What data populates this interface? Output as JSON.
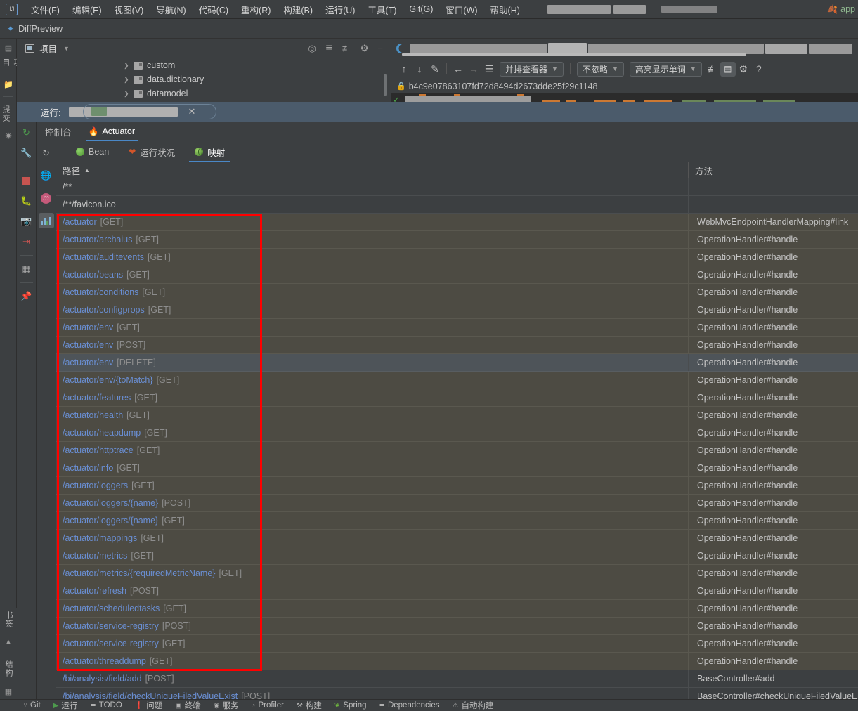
{
  "menubar": {
    "logo": "IJ",
    "items": [
      {
        "label": "文件(F)",
        "name": "menu-file"
      },
      {
        "label": "编辑(E)",
        "name": "menu-edit"
      },
      {
        "label": "视图(V)",
        "name": "menu-view"
      },
      {
        "label": "导航(N)",
        "name": "menu-navigate"
      },
      {
        "label": "代码(C)",
        "name": "menu-code"
      },
      {
        "label": "重构(R)",
        "name": "menu-refactor"
      },
      {
        "label": "构建(B)",
        "name": "menu-build"
      },
      {
        "label": "运行(U)",
        "name": "menu-run"
      },
      {
        "label": "工具(T)",
        "name": "menu-tools"
      },
      {
        "label": "Git(G)",
        "name": "menu-git"
      },
      {
        "label": "窗口(W)",
        "name": "menu-window"
      },
      {
        "label": "帮助(H)",
        "name": "menu-help"
      }
    ]
  },
  "navbar": {
    "breadcrumb": "DiffPreview",
    "star_icon": "star-icon"
  },
  "left_rail": {
    "top_label": "项目",
    "mid_label": "提交",
    "bottom_labels": [
      "书签",
      "结构"
    ]
  },
  "project_panel": {
    "title": "项目",
    "tools": [
      "locate-icon",
      "expand-all-icon",
      "collapse-all-icon",
      "gear-icon",
      "minimize-icon"
    ],
    "tree": [
      {
        "label": "custom"
      },
      {
        "label": "data.dictionary"
      },
      {
        "label": "datamodel"
      }
    ]
  },
  "diff_panel": {
    "app_chip_label": "app",
    "toolbar": {
      "prev_diff": "arrow-up-icon",
      "next_diff": "arrow-down-icon",
      "edit": "pencil-icon",
      "accept_left": "arrow-left-icon",
      "accept_right": "arrow-right-icon",
      "lines": "lines-icon",
      "viewer_mode": "并排查看器",
      "ignore_policy": "不忽略",
      "highlight_mode": "高亮显示单词",
      "collapse": "collapse-icon",
      "columns": "columns-icon",
      "settings": "gear-icon",
      "help": "?"
    },
    "revision_hash": "b4c9e07863107fd72d8494d2673dde25f29c1148",
    "lock_icon": "lock-icon"
  },
  "run_window": {
    "header_label": "运行:",
    "close_icon": "close-icon",
    "toolbar_icons": [
      "rerun-icon",
      "wrench-icon",
      "stop-icon",
      "debug-icon",
      "camera-icon",
      "export-icon",
      "layout-icon",
      "pin-icon"
    ],
    "tabs": [
      {
        "label": "控制台",
        "name": "tab-console",
        "active": false
      },
      {
        "label": "Actuator",
        "name": "tab-actuator",
        "active": true,
        "icon": "fire-icon"
      }
    ],
    "side_icons": [
      "refresh-icon",
      "globe-icon",
      "maven-icon",
      "chart-icon"
    ],
    "sub_tabs": [
      {
        "label": "Bean",
        "name": "subtab-bean",
        "icon": "bean-icon",
        "active": false
      },
      {
        "label": "运行状况",
        "name": "subtab-health",
        "icon": "heart-icon",
        "active": false
      },
      {
        "label": "映射",
        "name": "subtab-mappings",
        "icon": "globe-green-icon",
        "active": true
      }
    ]
  },
  "table": {
    "columns": [
      {
        "label": "路径",
        "sorted": "asc",
        "sort_icon": "sort-asc-icon"
      },
      {
        "label": "方法"
      }
    ],
    "rows": [
      {
        "path": "/**",
        "verb": "",
        "method": "",
        "group": "plain"
      },
      {
        "path": "/**/favicon.ico",
        "verb": "",
        "method": "",
        "group": "plain"
      },
      {
        "path": "/actuator",
        "verb": "[GET]",
        "method": "WebMvcEndpointHandlerMapping#link",
        "group": "actuator"
      },
      {
        "path": "/actuator/archaius",
        "verb": "[GET]",
        "method": "OperationHandler#handle",
        "group": "actuator"
      },
      {
        "path": "/actuator/auditevents",
        "verb": "[GET]",
        "method": "OperationHandler#handle",
        "group": "actuator"
      },
      {
        "path": "/actuator/beans",
        "verb": "[GET]",
        "method": "OperationHandler#handle",
        "group": "actuator"
      },
      {
        "path": "/actuator/conditions",
        "verb": "[GET]",
        "method": "OperationHandler#handle",
        "group": "actuator"
      },
      {
        "path": "/actuator/configprops",
        "verb": "[GET]",
        "method": "OperationHandler#handle",
        "group": "actuator"
      },
      {
        "path": "/actuator/env",
        "verb": "[GET]",
        "method": "OperationHandler#handle",
        "group": "actuator"
      },
      {
        "path": "/actuator/env",
        "verb": "[POST]",
        "method": "OperationHandler#handle",
        "group": "actuator"
      },
      {
        "path": "/actuator/env",
        "verb": "[DELETE]",
        "method": "OperationHandler#handle",
        "group": "selected"
      },
      {
        "path": "/actuator/env/{toMatch}",
        "verb": "[GET]",
        "method": "OperationHandler#handle",
        "group": "actuator"
      },
      {
        "path": "/actuator/features",
        "verb": "[GET]",
        "method": "OperationHandler#handle",
        "group": "actuator"
      },
      {
        "path": "/actuator/health",
        "verb": "[GET]",
        "method": "OperationHandler#handle",
        "group": "actuator"
      },
      {
        "path": "/actuator/heapdump",
        "verb": "[GET]",
        "method": "OperationHandler#handle",
        "group": "actuator"
      },
      {
        "path": "/actuator/httptrace",
        "verb": "[GET]",
        "method": "OperationHandler#handle",
        "group": "actuator"
      },
      {
        "path": "/actuator/info",
        "verb": "[GET]",
        "method": "OperationHandler#handle",
        "group": "actuator"
      },
      {
        "path": "/actuator/loggers",
        "verb": "[GET]",
        "method": "OperationHandler#handle",
        "group": "actuator"
      },
      {
        "path": "/actuator/loggers/{name}",
        "verb": "[POST]",
        "method": "OperationHandler#handle",
        "group": "actuator"
      },
      {
        "path": "/actuator/loggers/{name}",
        "verb": "[GET]",
        "method": "OperationHandler#handle",
        "group": "actuator"
      },
      {
        "path": "/actuator/mappings",
        "verb": "[GET]",
        "method": "OperationHandler#handle",
        "group": "actuator"
      },
      {
        "path": "/actuator/metrics",
        "verb": "[GET]",
        "method": "OperationHandler#handle",
        "group": "actuator"
      },
      {
        "path": "/actuator/metrics/{requiredMetricName}",
        "verb": "[GET]",
        "method": "OperationHandler#handle",
        "group": "actuator"
      },
      {
        "path": "/actuator/refresh",
        "verb": "[POST]",
        "method": "OperationHandler#handle",
        "group": "actuator"
      },
      {
        "path": "/actuator/scheduledtasks",
        "verb": "[GET]",
        "method": "OperationHandler#handle",
        "group": "actuator"
      },
      {
        "path": "/actuator/service-registry",
        "verb": "[POST]",
        "method": "OperationHandler#handle",
        "group": "actuator"
      },
      {
        "path": "/actuator/service-registry",
        "verb": "[GET]",
        "method": "OperationHandler#handle",
        "group": "actuator"
      },
      {
        "path": "/actuator/threaddump",
        "verb": "[GET]",
        "method": "OperationHandler#handle",
        "group": "actuator"
      },
      {
        "path": "/bi/analysis/field/add",
        "verb": "[POST]",
        "method": "BaseController#add",
        "group": "plain"
      },
      {
        "path": "/bi/analysis/field/checkUniqueFiledValueExist",
        "verb": "[POST]",
        "method": "BaseController#checkUniqueFiledValueE",
        "group": "plain"
      }
    ]
  },
  "annotation": {
    "shape": "rectangle",
    "color": "#ff0000"
  },
  "statusbar": {
    "items": [
      {
        "label": "Git",
        "icon": "git-icon"
      },
      {
        "label": "运行",
        "icon": "run-icon"
      },
      {
        "label": "TODO",
        "icon": "todo-icon"
      },
      {
        "label": "问题",
        "icon": "problems-icon"
      },
      {
        "label": "终端",
        "icon": "terminal-icon"
      },
      {
        "label": "服务",
        "icon": "services-icon"
      },
      {
        "label": "Profiler",
        "icon": "profiler-icon"
      },
      {
        "label": "构建",
        "icon": "build-icon"
      },
      {
        "label": "Spring",
        "icon": "spring-leaf-icon"
      },
      {
        "label": "Dependencies",
        "icon": "dependencies-icon"
      },
      {
        "label": "自动构建",
        "icon": "autobuild-icon"
      }
    ]
  }
}
